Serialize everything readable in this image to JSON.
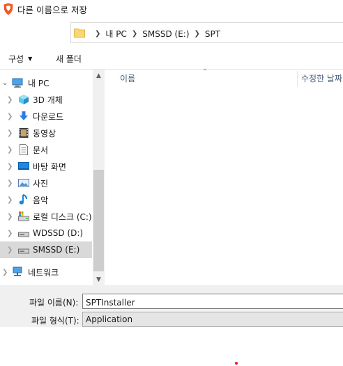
{
  "window": {
    "title": "다른 이름으로 저장"
  },
  "address": {
    "crumbs": [
      "내 PC",
      "SMSSD (E:)",
      "SPT"
    ]
  },
  "commands": {
    "organize": "구성",
    "new_folder": "새 폴더"
  },
  "nav": {
    "items": [
      {
        "label": "내 PC",
        "icon": "computer-icon",
        "level": 0,
        "expanded": true
      },
      {
        "label": "3D 개체",
        "icon": "3d-objects-icon",
        "level": 1
      },
      {
        "label": "다운로드",
        "icon": "download-icon",
        "level": 1
      },
      {
        "label": "동영상",
        "icon": "video-icon",
        "level": 1
      },
      {
        "label": "문서",
        "icon": "document-icon",
        "level": 1
      },
      {
        "label": "바탕 화면",
        "icon": "desktop-icon",
        "level": 1
      },
      {
        "label": "사진",
        "icon": "pictures-icon",
        "level": 1
      },
      {
        "label": "음악",
        "icon": "music-icon",
        "level": 1
      },
      {
        "label": "로컬 디스크 (C:)",
        "icon": "local-disk-icon",
        "level": 1
      },
      {
        "label": "WDSSD (D:)",
        "icon": "drive-icon",
        "level": 1
      },
      {
        "label": "SMSSD (E:)",
        "icon": "drive-icon",
        "level": 1,
        "selected": true
      },
      {
        "label": "네트워크",
        "icon": "network-icon",
        "level": 0
      }
    ]
  },
  "columns": {
    "name": "이름",
    "modified": "수정한 날짜"
  },
  "form": {
    "filename_label": "파일 이름(N):",
    "filename_value": "SPTInstaller",
    "filetype_label": "파일 형식(T):",
    "filetype_value": "Application"
  },
  "colors": {
    "accent": "#0078d7",
    "selected_bg": "#d9d9d9",
    "folder": "#f8d775",
    "brand": "#f15a24"
  }
}
